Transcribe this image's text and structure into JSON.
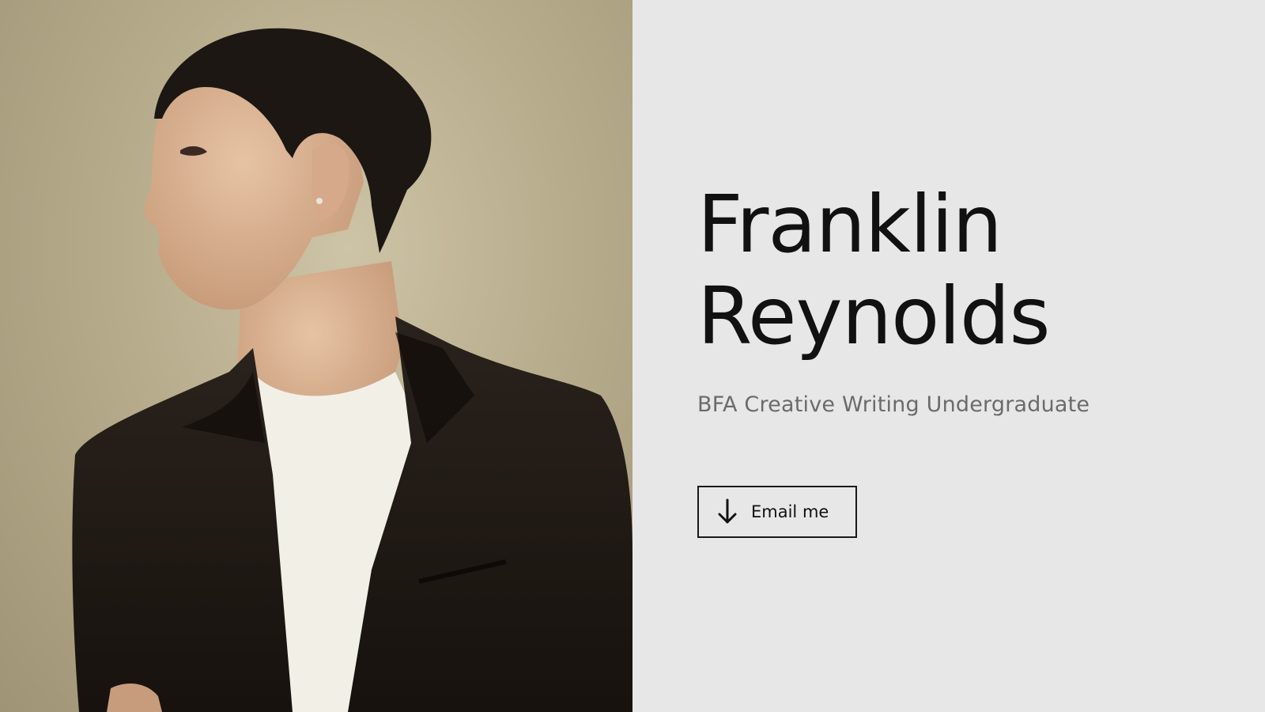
{
  "portrait": {
    "icon": "portrait-photo"
  },
  "profile": {
    "first_name": "Franklin",
    "last_name": "Reynolds",
    "subtitle": "BFA Creative Writing Undergraduate"
  },
  "cta": {
    "label": "Email me",
    "icon": "arrow-down-icon"
  },
  "colors": {
    "page_background": "#e8e7e8",
    "photo_background": "#b7ac8c",
    "name_text": "#111111",
    "subtitle_text": "#6b6b6b",
    "button_border": "#1a1a1a"
  }
}
